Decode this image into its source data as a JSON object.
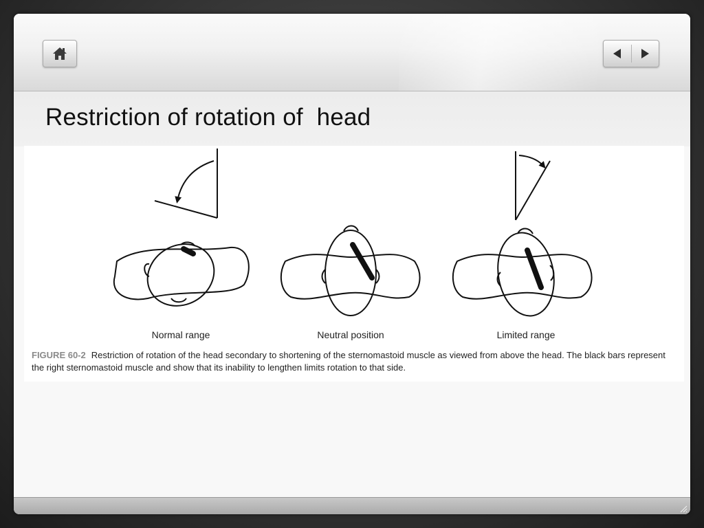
{
  "slide": {
    "title": "Restriction of rotation of  head"
  },
  "toolbar": {
    "home_icon": "home-icon",
    "prev_icon": "triangle-left-icon",
    "next_icon": "triangle-right-icon"
  },
  "figure": {
    "panels": [
      {
        "label": "Normal range"
      },
      {
        "label": "Neutral position"
      },
      {
        "label": "Limited range"
      }
    ],
    "caption_number": "FIGURE 60-2",
    "caption_text": "Restriction of rotation of the head secondary to shortening of the sternomastoid muscle as viewed from above the head. The black bars represent the right sternomastoid muscle and show that its inability to lengthen limits rotation to that side."
  },
  "colors": {
    "accent": "#8a8a8a",
    "background": "#f8f8f8"
  }
}
